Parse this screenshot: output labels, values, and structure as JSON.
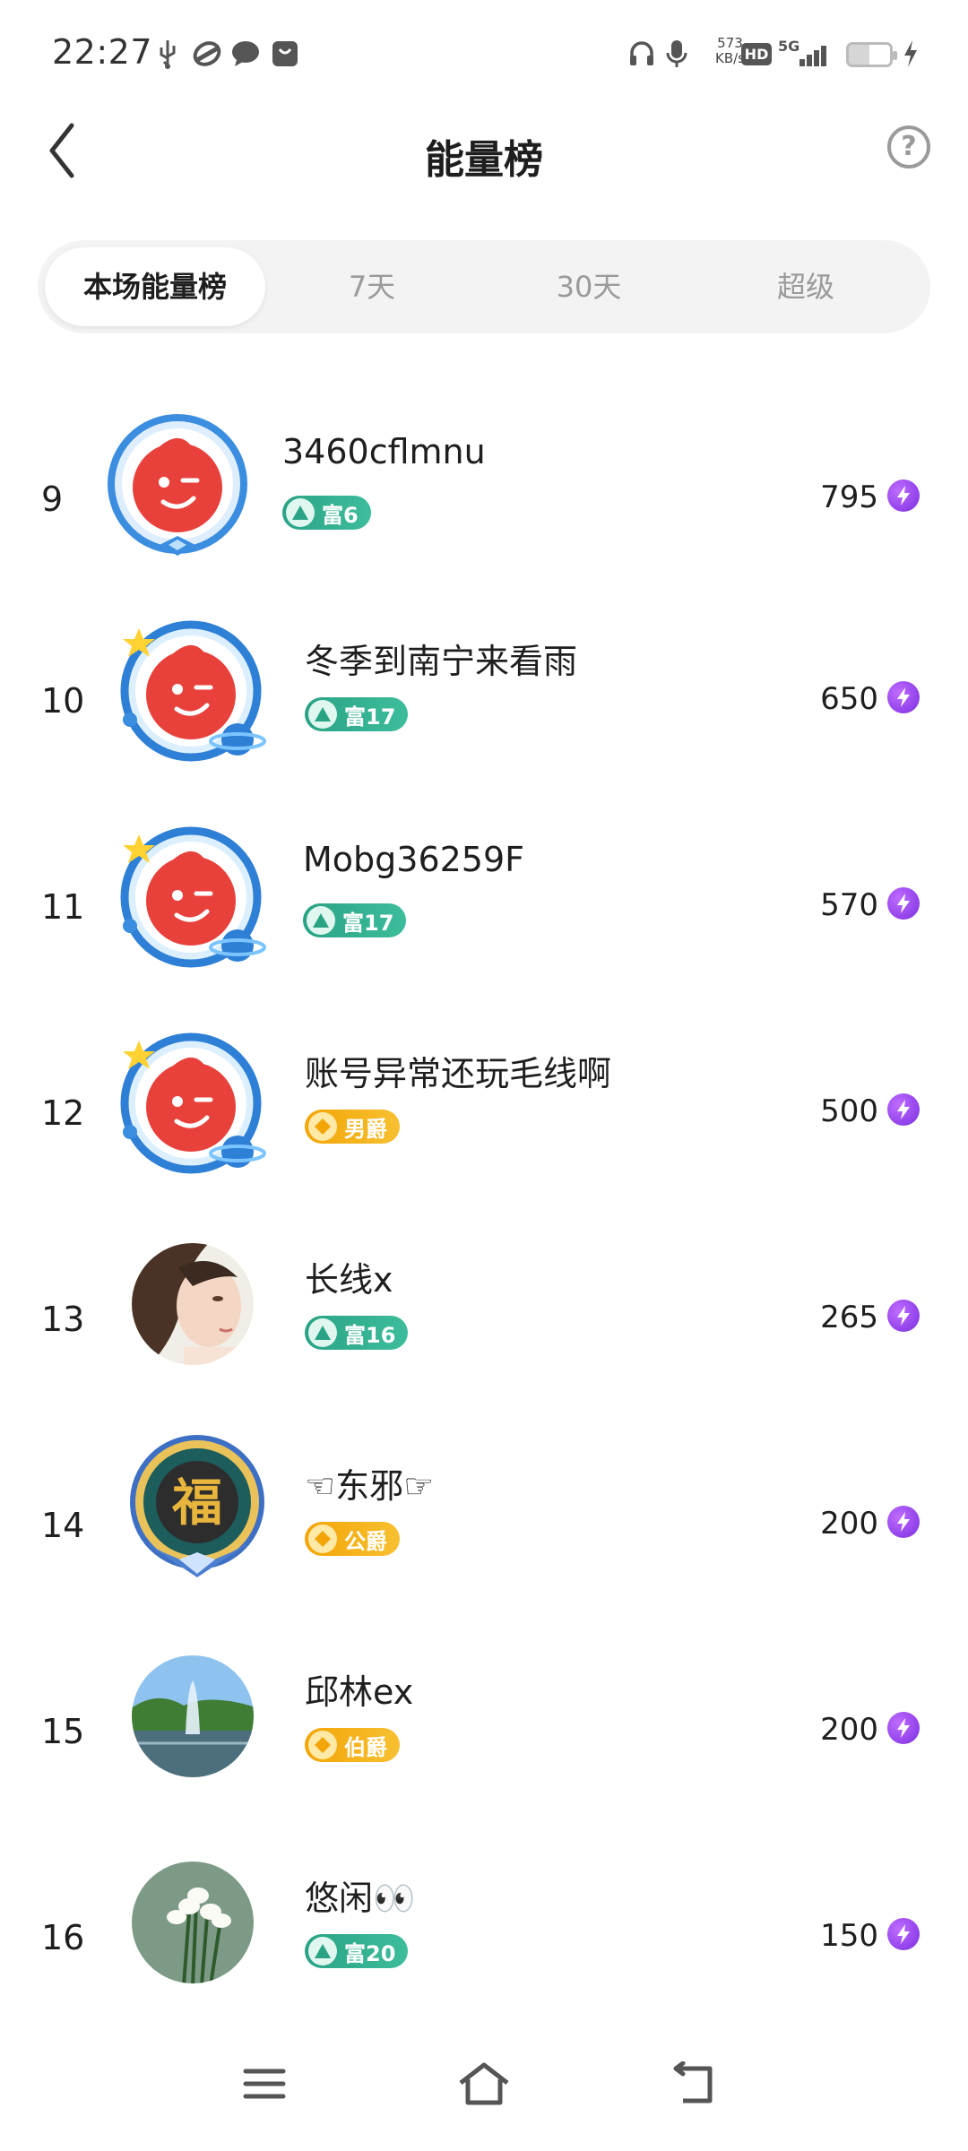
{
  "status_bar": {
    "time": "22:27",
    "speed_value": "573",
    "speed_unit": "KB/s",
    "hd": "HD",
    "network": "5G"
  },
  "header": {
    "title": "能量榜",
    "help_symbol": "?"
  },
  "tabs": [
    {
      "label": "本场能量榜",
      "active": true
    },
    {
      "label": "7天",
      "active": false
    },
    {
      "label": "30天",
      "active": false
    },
    {
      "label": "超级",
      "active": false
    }
  ],
  "ranking": [
    {
      "rank": "9",
      "name": "3460cflmnu",
      "badge": "富6",
      "badge_type": "rich",
      "score": "795",
      "avatar": "red-mascot-avatar-blue-frame"
    },
    {
      "rank": "10",
      "name": "冬季到南宁来看雨",
      "badge": "富17",
      "badge_type": "rich",
      "score": "650",
      "avatar": "red-mascot-avatar-planet-frame"
    },
    {
      "rank": "11",
      "name": "Mobg36259F",
      "badge": "富17",
      "badge_type": "rich",
      "score": "570",
      "avatar": "red-mascot-avatar-planet-frame"
    },
    {
      "rank": "12",
      "name": "账号异常还玩毛线啊",
      "badge": "男爵",
      "badge_type": "noble",
      "score": "500",
      "avatar": "red-mascot-avatar-planet-frame"
    },
    {
      "rank": "13",
      "name": "长线x",
      "badge": "富16",
      "badge_type": "rich",
      "score": "265",
      "avatar": "woman-portrait-avatar"
    },
    {
      "rank": "14",
      "name": "☜东邪☞",
      "badge": "公爵",
      "badge_type": "noble",
      "score": "200",
      "avatar": "fu-character-avatar"
    },
    {
      "rank": "15",
      "name": "邱林ex",
      "badge": "伯爵",
      "badge_type": "noble",
      "score": "200",
      "avatar": "lake-fountain-avatar"
    },
    {
      "rank": "16",
      "name": "悠闲👀",
      "badge": "富20",
      "badge_type": "rich",
      "score": "150",
      "avatar": "white-flowers-avatar"
    }
  ],
  "colors": {
    "rich_badge": "#2aa385",
    "noble_badge": "#f3a507",
    "energy_bolt": "#8a3cf0",
    "mascot_red": "#e8413b"
  }
}
